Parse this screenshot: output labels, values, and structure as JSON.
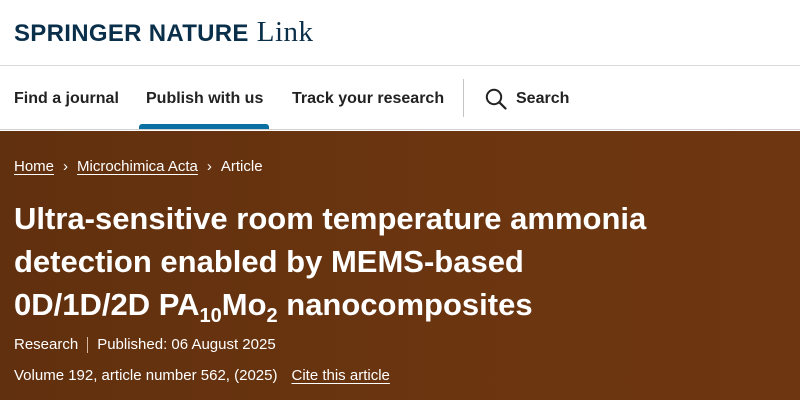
{
  "brand": {
    "name_main": "SPRINGER NATURE",
    "name_link": "Link"
  },
  "nav": {
    "items": [
      {
        "label": "Find a journal"
      },
      {
        "label": "Publish with us",
        "active": true
      },
      {
        "label": "Track your research"
      }
    ],
    "search_label": "Search",
    "search_icon": "search-icon",
    "active_color": "#0a6fa3"
  },
  "article": {
    "breadcrumb": [
      {
        "label": "Home"
      },
      {
        "label": "Microchimica Acta"
      },
      {
        "label": "Article"
      }
    ],
    "title_line1": "Ultra-sensitive room temperature ammonia",
    "title_line2": "detection enabled by MEMS-based",
    "title_line3_prefix": "0D/1D/2D PA",
    "title_sub1": "10",
    "title_mid": "Mo",
    "title_sub2": "2",
    "title_suffix": " nanocomposites",
    "type": "Research",
    "published": "Published: 06 August 2025",
    "volume_info": "Volume 192, article number 562, (2025)",
    "cite_label": "Cite this article"
  },
  "colors": {
    "brand_navy": "#0a2f4a",
    "hero_brown": "#6b3510"
  }
}
